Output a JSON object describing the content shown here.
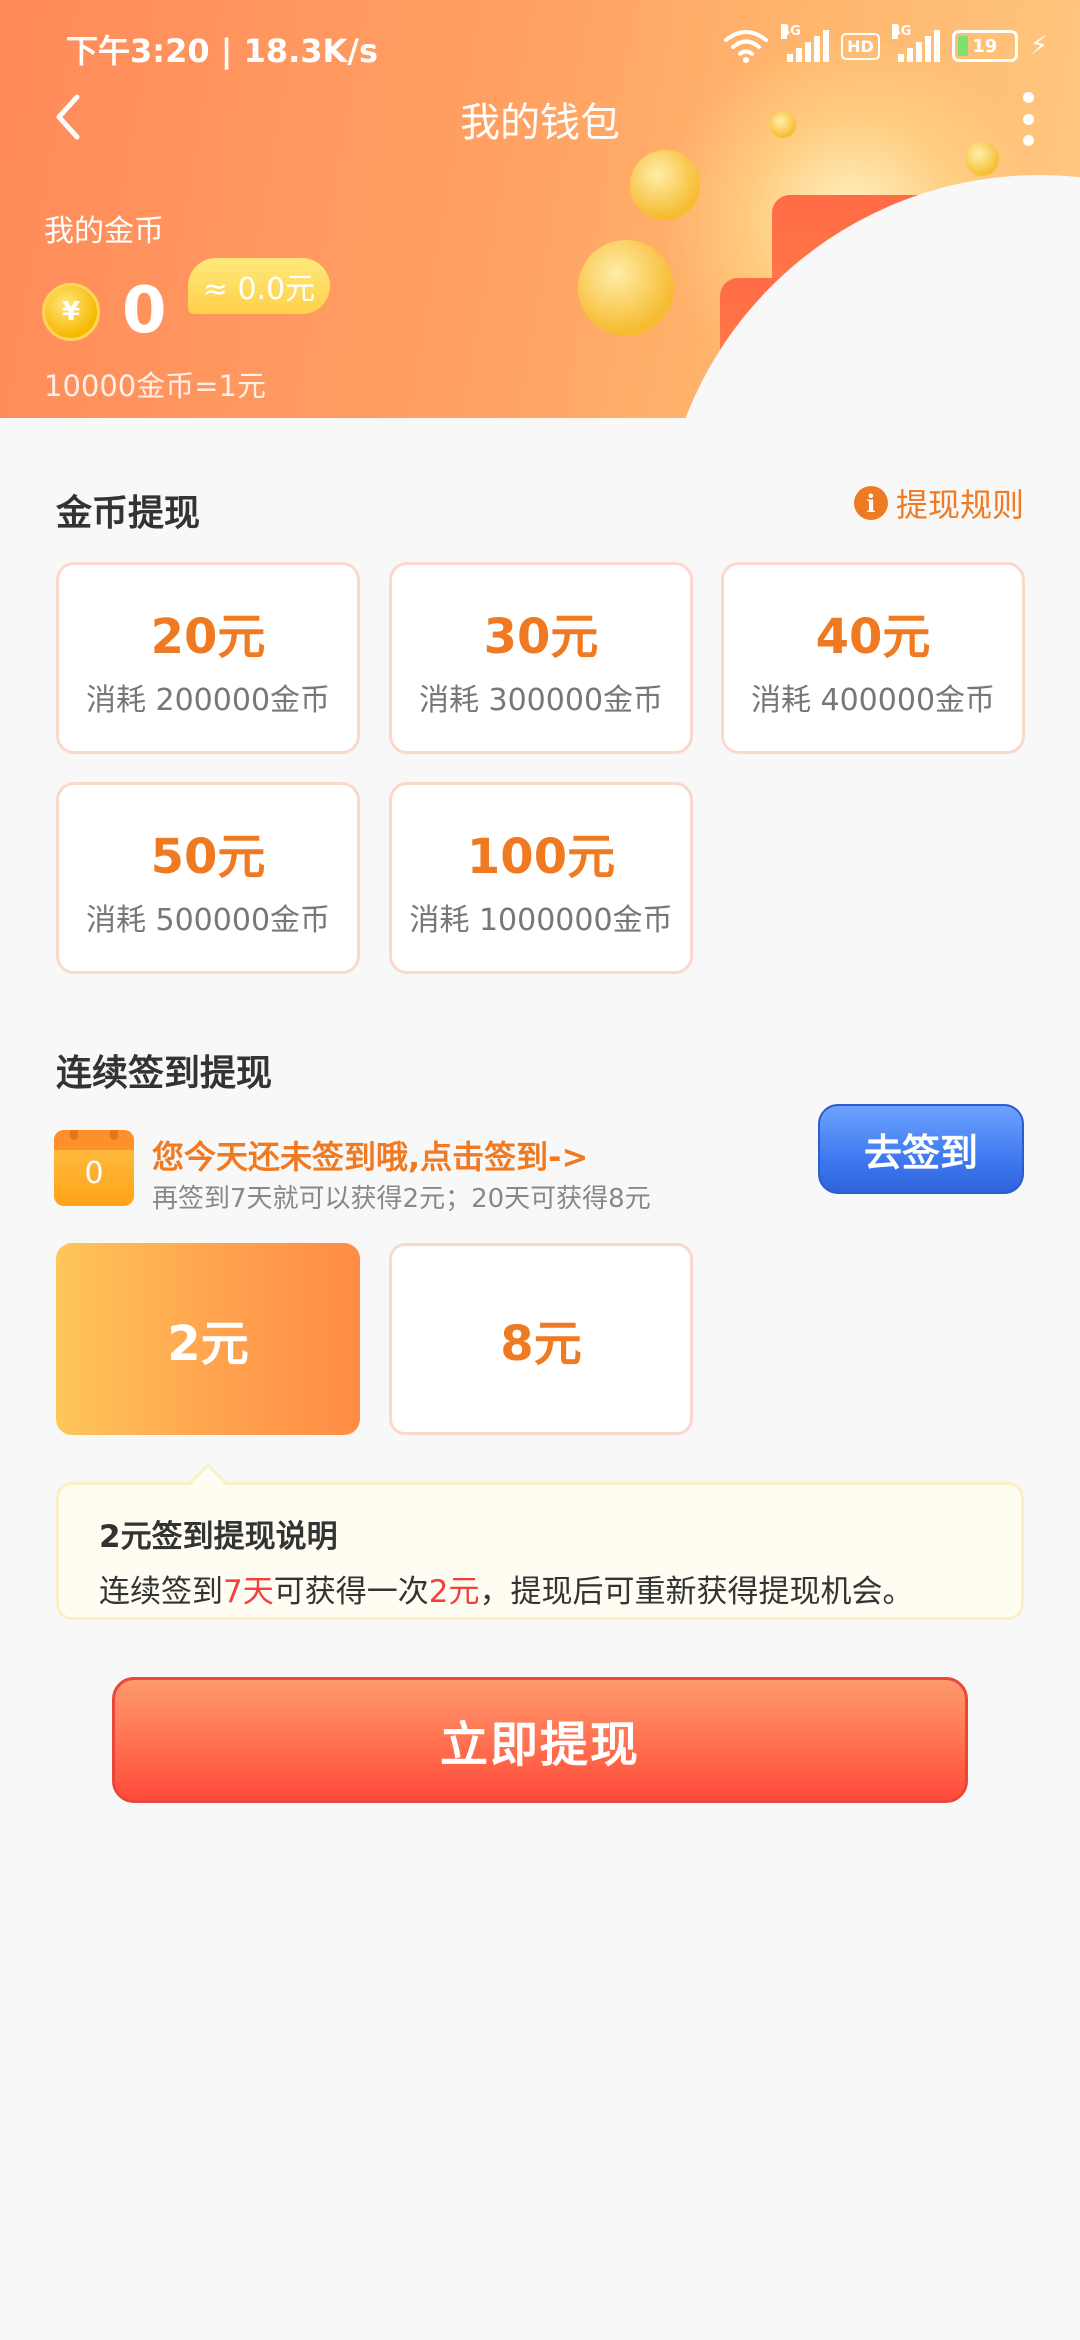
{
  "status_bar": {
    "time": "下午3:20 | 18.3K/s",
    "network": "4G",
    "hd": "HD",
    "battery": "19"
  },
  "header": {
    "title": "我的钱包"
  },
  "wallet": {
    "coins_label": "我的金币",
    "coins_value": "0",
    "coins_equivalent": "≈ 0.0元",
    "exchange_rate": "10000金币=1元",
    "coin_symbol": "¥"
  },
  "coin_withdraw": {
    "title": "金币提现",
    "rules_label": "提现规则",
    "options": [
      {
        "amount": "20元",
        "cost": "消耗 200000金币"
      },
      {
        "amount": "30元",
        "cost": "消耗 300000金币"
      },
      {
        "amount": "40元",
        "cost": "消耗 400000金币"
      },
      {
        "amount": "50元",
        "cost": "消耗 500000金币"
      },
      {
        "amount": "100元",
        "cost": "消耗 1000000金币"
      }
    ]
  },
  "checkin_withdraw": {
    "title": "连续签到提现",
    "calendar_day": "0",
    "headline": "您今天还未签到哦,点击签到->",
    "subtext": "再签到7天就可以获得2元；20天可获得8元",
    "checkin_button": "去签到",
    "rewards": [
      "2元",
      "8元"
    ],
    "selected_reward": "2元"
  },
  "explanation": {
    "title": "2元签到提现说明",
    "text_1": "连续签到",
    "text_days": "7天",
    "text_2": "可获得一次",
    "text_amount": "2元",
    "text_3": "，提现后可重新获得提现机会。"
  },
  "withdraw_button": "立即提现",
  "colors": {
    "accent": "#f07a22",
    "header_gradient_start": "#ff8a5a",
    "header_gradient_end": "#ffc981",
    "signin_button": "#3f7af0",
    "withdraw_button": "#ff5a40",
    "highlight_red": "#f24040"
  },
  "icons": [
    "back-arrow-icon",
    "more-vertical-icon",
    "coin-icon",
    "info-icon",
    "calendar-icon",
    "wifi-icon",
    "signal-icon",
    "battery-icon",
    "charging-icon"
  ]
}
